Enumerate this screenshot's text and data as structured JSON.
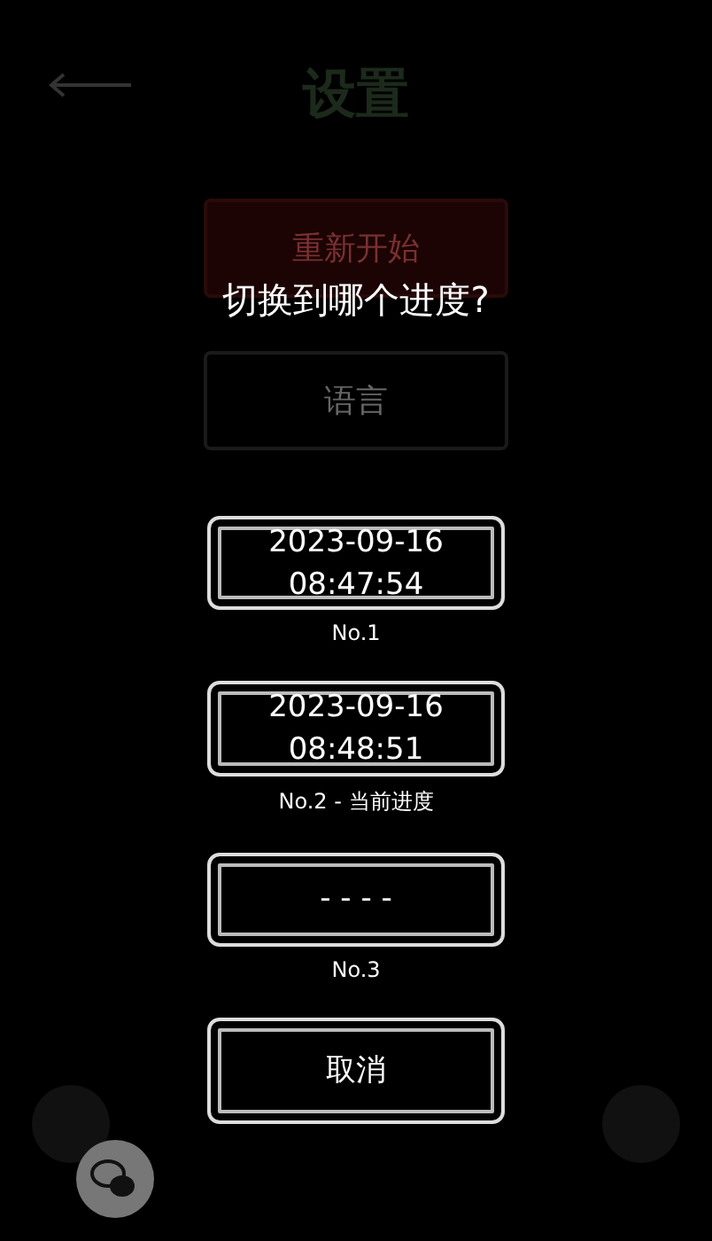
{
  "background": {
    "title": "设置",
    "buttons": [
      {
        "label": "重新开始",
        "kind": "danger"
      },
      {
        "label": "语言",
        "kind": "plain"
      }
    ]
  },
  "dialog": {
    "title": "切换到哪个进度?",
    "slots": [
      {
        "lines": [
          "2023-09-16",
          "08:47:54"
        ],
        "label": "No.1"
      },
      {
        "lines": [
          "2023-09-16",
          "08:48:51"
        ],
        "label": "No.2 - 当前进度"
      },
      {
        "lines": [
          "- - - -"
        ],
        "label": "No.3"
      }
    ],
    "cancel": "取消"
  }
}
